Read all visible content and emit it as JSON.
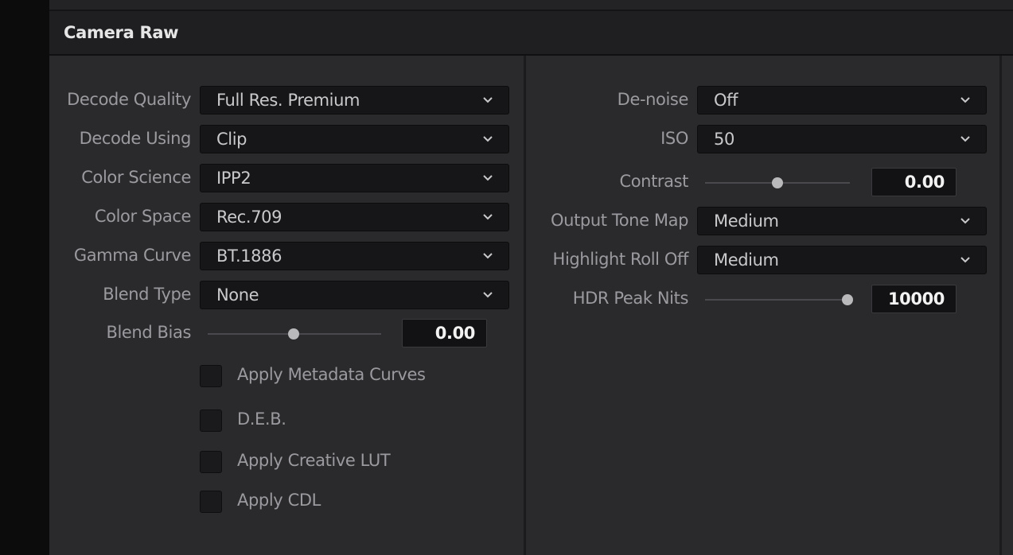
{
  "header": {
    "title": "Camera Raw"
  },
  "left": {
    "fields": [
      {
        "label": "Decode Quality",
        "value": "Full Res. Premium"
      },
      {
        "label": "Decode Using",
        "value": "Clip"
      },
      {
        "label": "Color Science",
        "value": "IPP2"
      },
      {
        "label": "Color Space",
        "value": "Rec.709"
      },
      {
        "label": "Gamma Curve",
        "value": "BT.1886"
      },
      {
        "label": "Blend Type",
        "value": "None"
      }
    ],
    "blend_bias": {
      "label": "Blend Bias",
      "value": "0.00",
      "slider_fraction": 0.5
    },
    "checkboxes": [
      {
        "label": "Apply Metadata Curves",
        "checked": false
      },
      {
        "label": "D.E.B.",
        "checked": false
      },
      {
        "label": "Apply Creative LUT",
        "checked": false
      },
      {
        "label": "Apply CDL",
        "checked": false
      }
    ]
  },
  "right": {
    "denoise": {
      "label": "De-noise",
      "value": "Off"
    },
    "iso": {
      "label": "ISO",
      "value": "50"
    },
    "contrast": {
      "label": "Contrast",
      "value": "0.00",
      "slider_fraction": 0.5
    },
    "output_tone_map": {
      "label": "Output Tone Map",
      "value": "Medium"
    },
    "highlight_roll_off": {
      "label": "Highlight Roll Off",
      "value": "Medium"
    },
    "hdr_peak_nits": {
      "label": "HDR Peak Nits",
      "value": "10000",
      "slider_fraction": 1.0
    }
  },
  "colors": {
    "panel_bg": "#2a2a2d",
    "header_bg": "#1f1f22",
    "field_bg": "#161618",
    "label_text": "#9b9b9f",
    "value_text": "#c9c9cc"
  },
  "icons": {
    "dropdown": "chevron-down-icon"
  }
}
